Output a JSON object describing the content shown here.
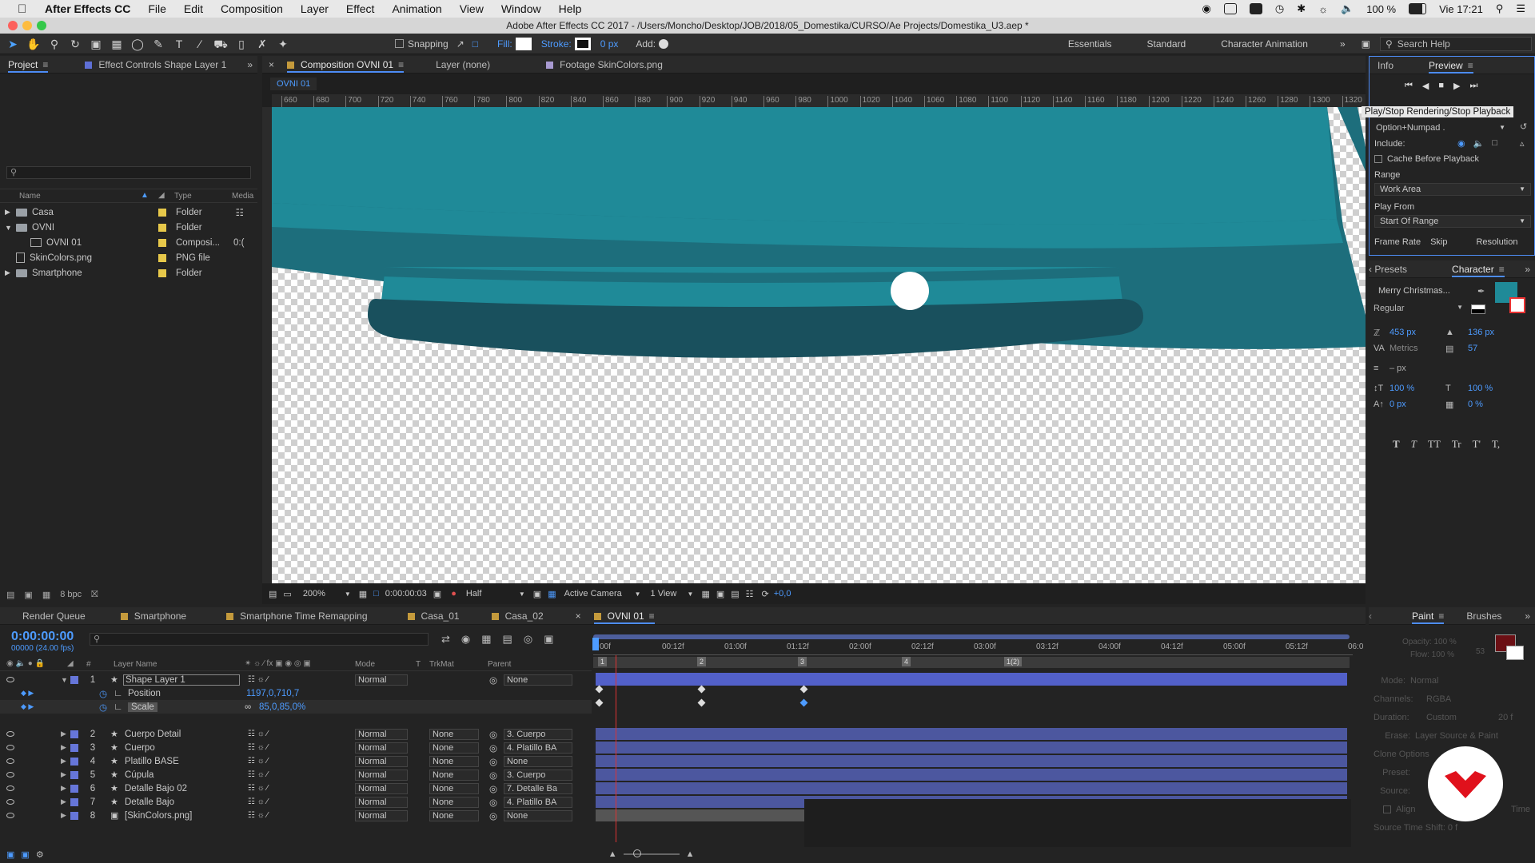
{
  "menubar": {
    "app_name": "After Effects CC",
    "items": [
      "File",
      "Edit",
      "Composition",
      "Layer",
      "Effect",
      "Animation",
      "View",
      "Window",
      "Help"
    ],
    "battery": "100 %",
    "clock": "Vie 17:21"
  },
  "window": {
    "title": "Adobe After Effects CC 2017 - /Users/Moncho/Desktop/JOB/2018/05_Domestika/CURSO/Ae Projects/Domestika_U3.aep *"
  },
  "toolbar": {
    "snapping": "Snapping",
    "fill_label": "Fill:",
    "stroke_label": "Stroke:",
    "stroke_value": "0 px",
    "add_label": "Add:",
    "workspaces": [
      "Essentials",
      "Standard",
      "Character Animation"
    ],
    "search_placeholder": "Search Help"
  },
  "project_panel": {
    "tabs": [
      "Project",
      "Effect Controls Shape Layer 1"
    ],
    "columns": [
      "Name",
      "Type",
      "Media"
    ],
    "items": [
      {
        "name": "Casa",
        "type": "Folder",
        "color": "#e7c84a"
      },
      {
        "name": "OVNI",
        "type": "Folder",
        "color": "#e7c84a"
      },
      {
        "name": "OVNI 01",
        "type": "Composi...",
        "media": "0:(",
        "color": "#e7c84a"
      },
      {
        "name": "SkinColors.png",
        "type": "PNG file",
        "color": "#e7c84a"
      },
      {
        "name": "Smartphone",
        "type": "Folder",
        "color": "#e7c84a"
      }
    ],
    "bpc": "8 bpc"
  },
  "viewer": {
    "tabs": [
      "Composition OVNI 01",
      "Layer (none)",
      "Footage SkinColors.png"
    ],
    "comp_tab_name": "OVNI 01",
    "ruler_marks": [
      "660",
      "680",
      "700",
      "720",
      "740",
      "760",
      "780",
      "800",
      "820",
      "840",
      "860",
      "880",
      "900",
      "920",
      "940",
      "960",
      "980",
      "1000",
      "1020",
      "1040",
      "1060",
      "1080",
      "1100",
      "1120",
      "1140",
      "1160",
      "1180",
      "1200",
      "1220",
      "1240",
      "1260",
      "1280",
      "1300",
      "1320"
    ],
    "zoom": "200%",
    "timecode": "0:00:00:03",
    "resolution": "Half",
    "camera": "Active Camera",
    "views": "1 View",
    "exposure": "+0,0",
    "colors": {
      "teal": "#1f8a98",
      "teal_dark": "#1d6e7c",
      "dark": "#19505d",
      "white": "#ffffff"
    }
  },
  "preview_panel": {
    "tabs": [
      "Info",
      "Preview"
    ],
    "tooltip": "Play/Stop Rendering/Stop Playback",
    "shortcut": "Option+Numpad .",
    "include_label": "Include:",
    "cache_label": "Cache Before Playback",
    "range_label": "Range",
    "range_value": "Work Area",
    "play_from_label": "Play From",
    "play_from_value": "Start Of Range",
    "bottom_labels": [
      "Frame Rate",
      "Skip",
      "Resolution"
    ]
  },
  "character_panel": {
    "tabs": [
      "Presets",
      "Character"
    ],
    "font": "Merry Christmas...",
    "style": "Regular",
    "font_size": "453 px",
    "leading": "136 px",
    "kerning": "Metrics",
    "tracking": "57",
    "stroke_width": "– px",
    "vert_scale": "100 %",
    "horiz_scale": "100 %",
    "baseline": "0 px",
    "tsume": "0 %",
    "fill_color": "#1f8a98",
    "style_buttons": [
      "T",
      "T",
      "TT",
      "Tr",
      "T'",
      "T,"
    ]
  },
  "bottom_tabs": [
    "Render Queue",
    "Smartphone",
    "Smartphone Time Remapping",
    "Casa_01",
    "Casa_02",
    "OVNI 01"
  ],
  "timeline": {
    "timecode": "0:00:00:00",
    "fps": "00000 (24.00 fps)",
    "columns": [
      "#",
      "Layer Name",
      "Mode",
      "T",
      "TrkMat",
      "Parent"
    ],
    "ruler": [
      "00f",
      "00:12f",
      "01:00f",
      "01:12f",
      "02:00f",
      "02:12f",
      "03:00f",
      "03:12f",
      "04:00f",
      "04:12f",
      "05:00f",
      "05:12f",
      "06:0"
    ],
    "markers": [
      "1",
      "2",
      "3",
      "4",
      "1(2)"
    ],
    "layers": [
      {
        "num": "1",
        "name": "Shape Layer 1",
        "mode": "Normal",
        "trk": "",
        "parent": "None"
      },
      {
        "num": "2",
        "name": "Cuerpo Detail",
        "mode": "Normal",
        "trk": "None",
        "parent": "3. Cuerpo"
      },
      {
        "num": "3",
        "name": "Cuerpo",
        "mode": "Normal",
        "trk": "None",
        "parent": "4. Platillo BA"
      },
      {
        "num": "4",
        "name": "Platillo BASE",
        "mode": "Normal",
        "trk": "None",
        "parent": "None"
      },
      {
        "num": "5",
        "name": "Cúpula",
        "mode": "Normal",
        "trk": "None",
        "parent": "3. Cuerpo"
      },
      {
        "num": "6",
        "name": "Detalle Bajo 02",
        "mode": "Normal",
        "trk": "None",
        "parent": "7. Detalle Ba"
      },
      {
        "num": "7",
        "name": "Detalle Bajo",
        "mode": "Normal",
        "trk": "None",
        "parent": "4. Platillo BA"
      },
      {
        "num": "8",
        "name": "[SkinColors.png]",
        "mode": "Normal",
        "trk": "None",
        "parent": "None"
      }
    ],
    "props": [
      {
        "name": "Position",
        "value": "1197,0,710,7"
      },
      {
        "name": "Scale",
        "value": "85,0,85,0%"
      }
    ]
  },
  "paint_panel": {
    "tabs": [
      "Paint",
      "Brushes"
    ],
    "opacity": "Opacity: 100 %",
    "flow": "Flow: 100 %",
    "brush_size": "53",
    "mode": "Mode:",
    "mode_value": "Normal",
    "channels": "Channels:",
    "channels_value": "RGBA",
    "duration": "Duration:",
    "duration_value": "Custom",
    "duration_num": "20 f",
    "erase": "Erase:",
    "erase_value": "Layer Source & Paint",
    "clone_options": "Clone Options",
    "preset": "Preset:",
    "source": "Source:",
    "align": "Align",
    "time": "Time",
    "source_time_shift": "Source Time Shift: 0 f",
    "fg_color": "#6b0f14",
    "logo_color": "#e0111c"
  }
}
